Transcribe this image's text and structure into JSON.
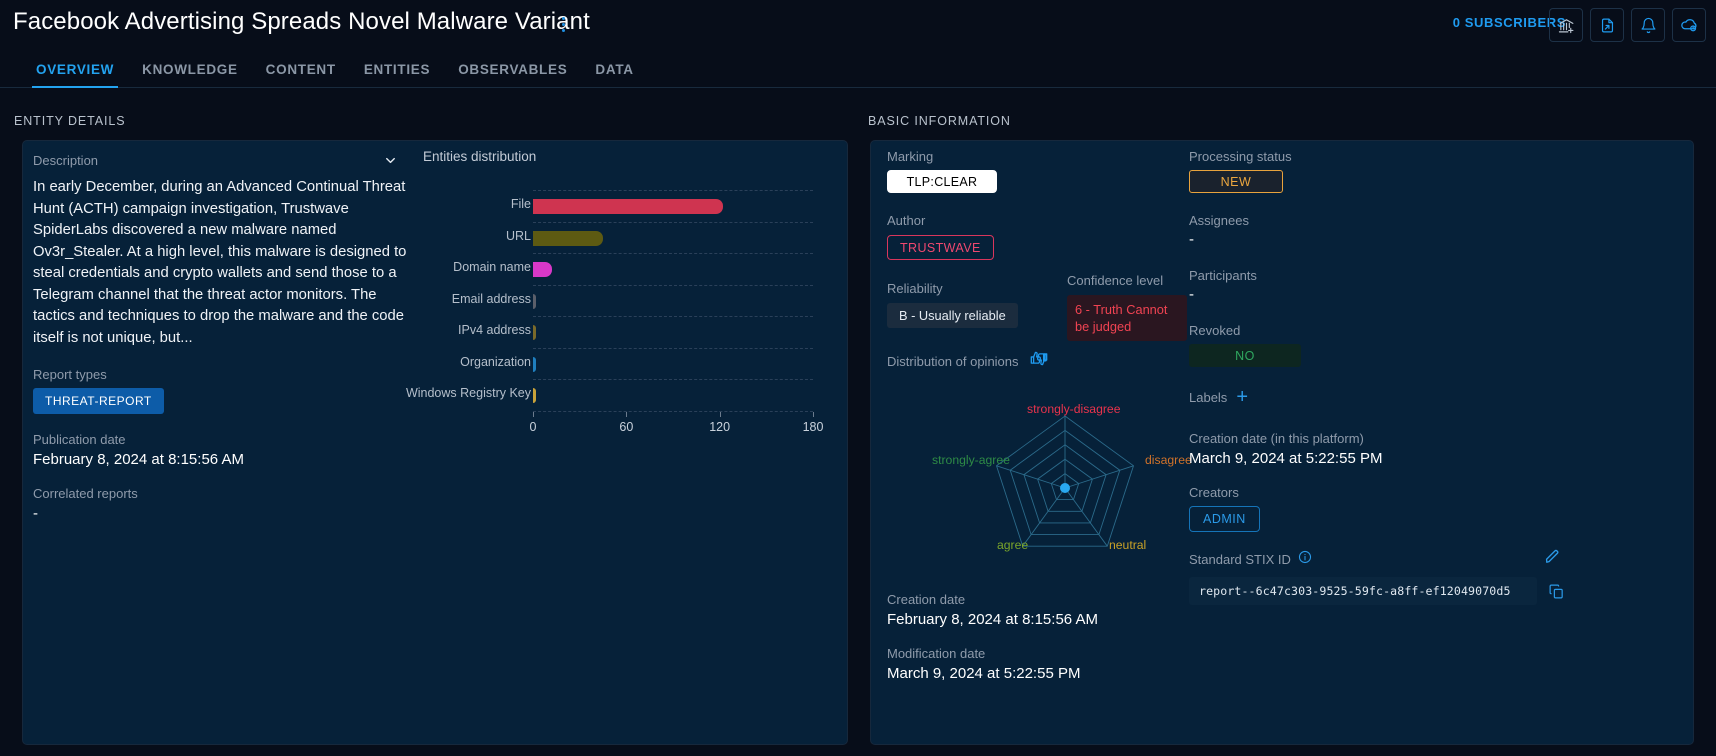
{
  "header": {
    "title": "Facebook Advertising Spreads Novel Malware Variant",
    "subscribers": "0 SUBSCRIBERS",
    "buttons": [
      {
        "name": "add-to-container-button",
        "icon": "bank-plus-icon"
      },
      {
        "name": "export-file-button",
        "icon": "file-export-icon"
      },
      {
        "name": "notifications-button",
        "icon": "bell-icon"
      },
      {
        "name": "sync-cloud-button",
        "icon": "cloud-refresh-icon"
      }
    ]
  },
  "tabs": [
    {
      "label": "OVERVIEW",
      "active": true
    },
    {
      "label": "KNOWLEDGE",
      "active": false
    },
    {
      "label": "CONTENT",
      "active": false
    },
    {
      "label": "ENTITIES",
      "active": false
    },
    {
      "label": "OBSERVABLES",
      "active": false
    },
    {
      "label": "DATA",
      "active": false
    }
  ],
  "sections": {
    "entity_details": "ENTITY DETAILS",
    "basic_information": "BASIC INFORMATION"
  },
  "entity_details": {
    "description_label": "Description",
    "description_text": "In early December, during an Advanced Continual Threat Hunt (ACTH) campaign investigation, Trustwave SpiderLabs discovered a new malware named Ov3r_Stealer. At a high level, this malware is designed to steal credentials and crypto wallets and send those to a Telegram channel that the threat actor monitors. The tactics and techniques to drop the malware and the code itself is not unique, but...",
    "report_types_label": "Report types",
    "report_type": "THREAT-REPORT",
    "publication_date_label": "Publication date",
    "publication_date": "February 8, 2024 at 8:15:56 AM",
    "correlated_reports_label": "Correlated reports",
    "correlated_reports": "-"
  },
  "chart_data": {
    "type": "bar",
    "title": "Entities distribution",
    "orientation": "horizontal",
    "categories": [
      "File",
      "URL",
      "Domain name",
      "Email address",
      "IPv4 address",
      "Organization",
      "Windows Registry Key"
    ],
    "values": [
      122,
      45,
      12,
      2,
      2,
      2,
      2
    ],
    "colors": [
      "#cf3450",
      "#5d5a12",
      "#d838c8",
      "#5b5f6a",
      "#7a6a2a",
      "#1f7fbf",
      "#c8a23a"
    ],
    "xlabel": "",
    "ylabel": "",
    "xlim": [
      0,
      180
    ],
    "xticks": [
      0,
      60,
      120,
      180
    ],
    "xticklabels": [
      "0",
      "60",
      "120",
      "180"
    ],
    "grid": true,
    "legend": false
  },
  "basic_information": {
    "marking_label": "Marking",
    "marking_value": "TLP:CLEAR",
    "author_label": "Author",
    "author_value": "TRUSTWAVE",
    "reliability_label": "Reliability",
    "reliability_value": "B - Usually reliable",
    "confidence_label": "Confidence level",
    "confidence_value": "6 - Truth Cannot be judged",
    "opinions_label": "Distribution of opinions",
    "creation_date_label": "Creation date",
    "creation_date": "February 8, 2024 at 8:15:56 AM",
    "modification_date_label": "Modification date",
    "modification_date": "March 9, 2024 at 5:22:55 PM",
    "processing_status_label": "Processing status",
    "processing_status": "NEW",
    "assignees_label": "Assignees",
    "assignees": "-",
    "participants_label": "Participants",
    "participants": "-",
    "revoked_label": "Revoked",
    "revoked": "NO",
    "labels_label": "Labels",
    "platform_creation_label": "Creation date (in this platform)",
    "platform_creation_date": "March 9, 2024 at 5:22:55 PM",
    "creators_label": "Creators",
    "creator": "ADMIN",
    "stix_label": "Standard STIX ID",
    "stix_id": "report--6c47c303-9525-59fc-a8ff-ef12049070d5"
  },
  "opinions_chart": {
    "type": "radar",
    "axes": [
      {
        "label": "strongly-disagree",
        "color": "#e8334c",
        "value": 0
      },
      {
        "label": "disagree",
        "color": "#d0722a",
        "value": 0
      },
      {
        "label": "neutral",
        "color": "#c9a227",
        "value": 0
      },
      {
        "label": "agree",
        "color": "#7aa52a",
        "value": 0
      },
      {
        "label": "strongly-agree",
        "color": "#2e8b46",
        "value": 0
      }
    ],
    "rings": 5,
    "point_color": "#29a8f0"
  },
  "colors": {
    "accent": "#23a3f0",
    "panel_bg": "#062139",
    "page_bg": "#070d19",
    "border": "#16283c"
  }
}
